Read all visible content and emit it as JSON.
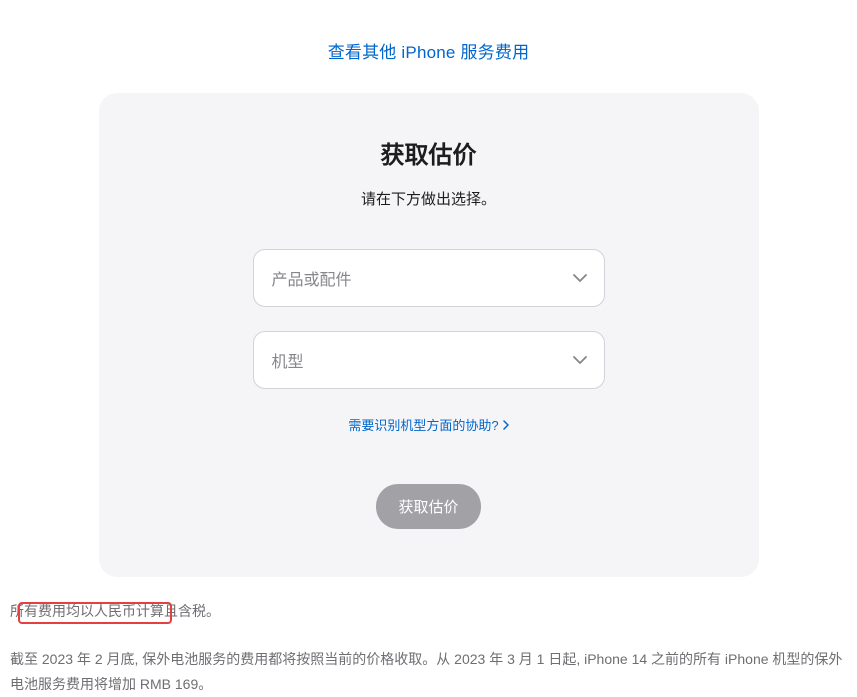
{
  "topLink": {
    "label": "查看其他 iPhone 服务费用"
  },
  "card": {
    "title": "获取估价",
    "subtitle": "请在下方做出选择。",
    "select1": {
      "placeholder": "产品或配件"
    },
    "select2": {
      "placeholder": "机型"
    },
    "helpLink": {
      "label": "需要识别机型方面的协助?"
    },
    "button": {
      "label": "获取估价"
    }
  },
  "footer": {
    "line1": "所有费用均以人民币计算且含税。",
    "line2": "截至 2023 年 2 月底, 保外电池服务的费用都将按照当前的价格收取。从 2023 年 3 月 1 日起, iPhone 14 之前的所有 iPhone 机型的保外电池服务费用将增加 RMB 169。"
  }
}
